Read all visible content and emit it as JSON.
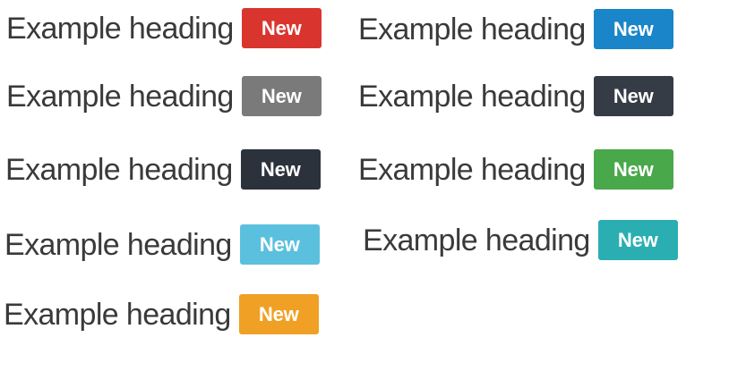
{
  "headings": [
    {
      "text": "Example heading",
      "badge": "New",
      "color": "#d9352e"
    },
    {
      "text": "Example heading",
      "badge": "New",
      "color": "#1a85c8"
    },
    {
      "text": "Example heading",
      "badge": "New",
      "color": "#7a7a7a"
    },
    {
      "text": "Example heading",
      "badge": "New",
      "color": "#363c45"
    },
    {
      "text": "Example heading",
      "badge": "New",
      "color": "#2b323b"
    },
    {
      "text": "Example heading",
      "badge": "New",
      "color": "#48a84a"
    },
    {
      "text": "Example heading",
      "badge": "New",
      "color": "#5bc0de"
    },
    {
      "text": "Example heading",
      "badge": "New",
      "color": "#2baeb1"
    },
    {
      "text": "Example heading",
      "badge": "New",
      "color": "#f0a025"
    }
  ]
}
